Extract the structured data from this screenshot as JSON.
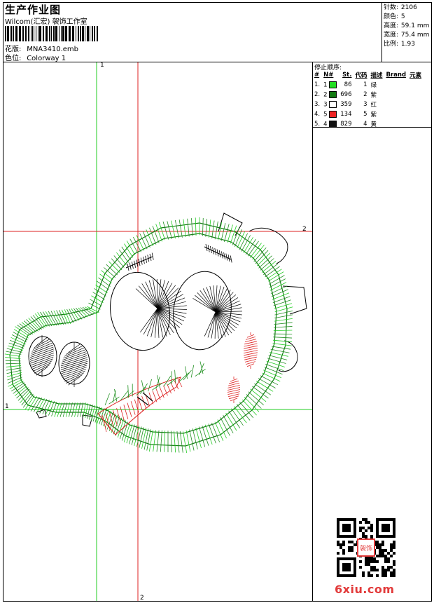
{
  "header": {
    "title": "生产作业图",
    "studio": "Wilcom(汇宏) 袈饰工作室",
    "design_file_label": "花版:",
    "design_file": "MNA3410.emb",
    "colorway_label": "色位:",
    "colorway": "Colorway 1"
  },
  "stats": [
    {
      "label": "针数:",
      "value": "2106"
    },
    {
      "label": "颜色:",
      "value": "5"
    },
    {
      "label": "高度:",
      "value": "59.1 mm"
    },
    {
      "label": "宽度:",
      "value": "75.4 mm"
    },
    {
      "label": "比例:",
      "value": "1.93"
    }
  ],
  "stop_sequence": {
    "title": "停止顺序:",
    "headers": [
      "#",
      "N#",
      "St.",
      "代码",
      "描述",
      "Brand",
      "元素"
    ],
    "rows": [
      {
        "num": "1.",
        "n": "1",
        "color": "#22dd22",
        "stitches": "86",
        "code": "1",
        "desc": "绿"
      },
      {
        "num": "2.",
        "n": "2",
        "color": "#127a12",
        "stitches": "696",
        "code": "2",
        "desc": "紫"
      },
      {
        "num": "3.",
        "n": "3",
        "color": "#ffffff",
        "stitches": "359",
        "code": "3",
        "desc": "红"
      },
      {
        "num": "4.",
        "n": "5",
        "color": "#ee2222",
        "stitches": "134",
        "code": "5",
        "desc": "紫"
      },
      {
        "num": "5.",
        "n": "4",
        "color": "#111111",
        "stitches": "829",
        "code": "4",
        "desc": "黄"
      }
    ]
  },
  "guides": {
    "h_green_label": "1",
    "v_green_label": "1",
    "h_red_label": "2",
    "v_red_label": "2",
    "green": "#22cc22",
    "red": "#dd2222"
  },
  "watermark": "6xiu.com",
  "qr_stamp": "袈饰"
}
